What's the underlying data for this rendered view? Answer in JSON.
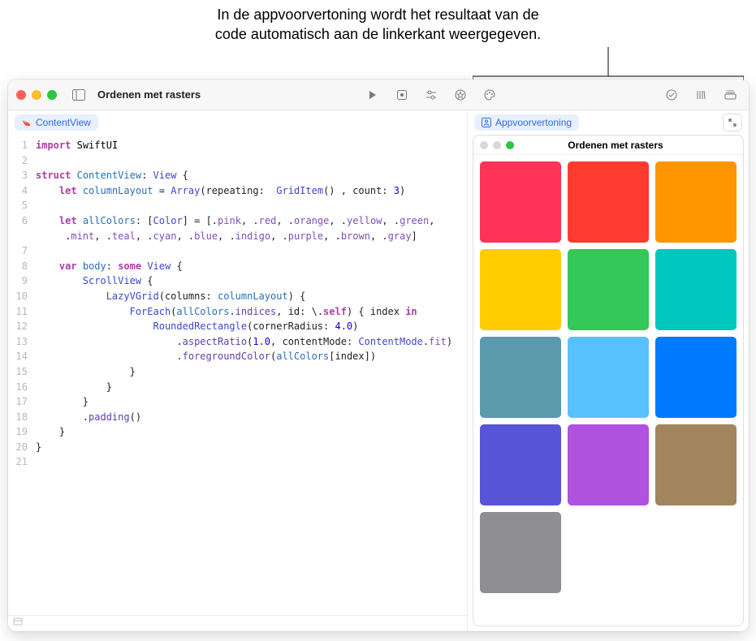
{
  "caption_line1": "In de appvoorvertoning wordt het resultaat van de",
  "caption_line2": "code automatisch aan de linkerkant weergegeven.",
  "window": {
    "title": "Ordenen met rasters"
  },
  "editor": {
    "tab_label": "ContentView",
    "lines": [
      {
        "n": 1,
        "html": "<span class='kw'>import</span> <span class='plain'>SwiftUI</span>"
      },
      {
        "n": 2,
        "html": ""
      },
      {
        "n": 3,
        "html": "<span class='kw'>struct</span> <span class='decl'>ContentView</span>: <span class='type'>View</span> {"
      },
      {
        "n": 4,
        "html": "    <span class='kw'>let</span> <span class='id'>columnLayout</span> = <span class='type'>Array</span>(repeating:  <span class='type'>GridItem</span>() , count: <span class='num'>3</span>)"
      },
      {
        "n": 5,
        "html": ""
      },
      {
        "n": 6,
        "html": "    <span class='kw'>let</span> <span class='id'>allColors</span>: [<span class='type'>Color</span>] = [.<span class='en'>pink</span>, .<span class='en'>red</span>, .<span class='en'>orange</span>, .<span class='en'>yellow</span>, .<span class='en'>green</span>,\n     .<span class='en'>mint</span>, .<span class='en'>teal</span>, .<span class='en'>cyan</span>, .<span class='en'>blue</span>, .<span class='en'>indigo</span>, .<span class='en'>purple</span>, .<span class='en'>brown</span>, .<span class='en'>gray</span>]"
      },
      {
        "n": 7,
        "html": ""
      },
      {
        "n": 8,
        "html": "    <span class='kw'>var</span> <span class='id'>body</span>: <span class='kw'>some</span> <span class='type'>View</span> {"
      },
      {
        "n": 9,
        "html": "        <span class='type'>ScrollView</span> {"
      },
      {
        "n": 10,
        "html": "            <span class='type'>LazyVGrid</span>(columns: <span class='id'>columnLayout</span>) {"
      },
      {
        "n": 11,
        "html": "                <span class='type'>ForEach</span>(<span class='id'>allColors</span>.<span class='fn'>indices</span>, id: \\.<span class='kw'>self</span>) { index <span class='kw'>in</span>"
      },
      {
        "n": 12,
        "html": "                    <span class='type'>RoundedRectangle</span>(cornerRadius: <span class='num'>4.0</span>)"
      },
      {
        "n": 13,
        "html": "                        .<span class='fn'>aspectRatio</span>(<span class='num'>1.0</span>, contentMode: <span class='type'>ContentMode</span>.<span class='en'>fit</span>)"
      },
      {
        "n": 14,
        "html": "                        .<span class='fn'>foregroundColor</span>(<span class='id'>allColors</span>[index])"
      },
      {
        "n": 15,
        "html": "                }"
      },
      {
        "n": 16,
        "html": "            }"
      },
      {
        "n": 17,
        "html": "        }"
      },
      {
        "n": 18,
        "html": "        .<span class='fn'>padding</span>()"
      },
      {
        "n": 19,
        "html": "    }"
      },
      {
        "n": 20,
        "html": "}"
      },
      {
        "n": 21,
        "html": ""
      }
    ]
  },
  "preview": {
    "tab_label": "Appvoorvertoning",
    "window_title": "Ordenen met rasters",
    "colors": [
      "#ff3258",
      "#ff3b30",
      "#ff9500",
      "#ffcc00",
      "#34c759",
      "#00c7be",
      "#5b9aad",
      "#59c1ff",
      "#007aff",
      "#5856d6",
      "#af52de",
      "#a2845e",
      "#8e8e93"
    ]
  }
}
